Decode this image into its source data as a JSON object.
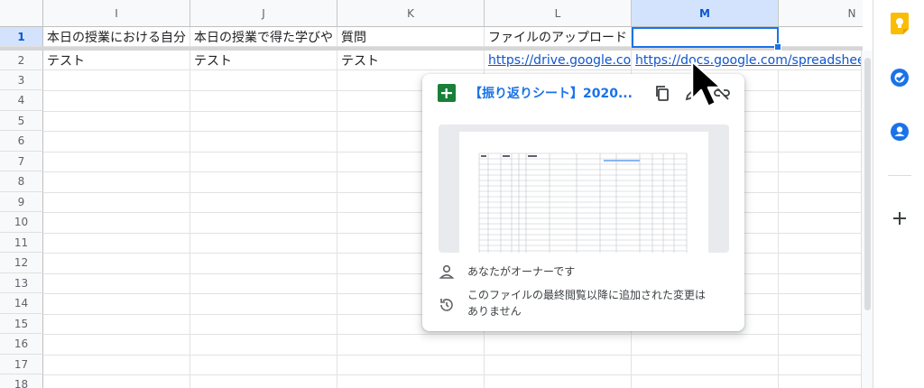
{
  "columns": [
    "I",
    "J",
    "K",
    "L",
    "M",
    "N"
  ],
  "rows": [
    "1",
    "2",
    "3",
    "4",
    "5",
    "6",
    "7",
    "8",
    "9",
    "10",
    "11",
    "12",
    "13",
    "14",
    "15",
    "16",
    "17",
    "18"
  ],
  "cells": {
    "r1": [
      "本日の授業における自分",
      "本日の授業で得た学びや",
      "質問",
      "ファイルのアップロード",
      "",
      ""
    ],
    "r2": [
      "テスト",
      "テスト",
      "テスト",
      "https://drive.google.com/",
      "https://docs.google.com/spreadsheets/d",
      ""
    ]
  },
  "link_card": {
    "title": "【振り返りシート】2020...",
    "owner_text": "あなたがオーナーです",
    "changes_line1": "このファイルの最終閲覧以降に追加された変更は",
    "changes_line2": "ありません",
    "icons": [
      "sheets-icon",
      "copy-link-icon",
      "edit-link-icon",
      "unlink-icon",
      "person-icon",
      "history-icon"
    ]
  },
  "side_panel": {
    "icons": [
      "keep-icon",
      "tasks-icon",
      "contacts-icon",
      "add-icon"
    ]
  },
  "colors": {
    "accent": "#1a73e8",
    "link": "#1155cc",
    "header_bg": "#f8f9fa",
    "sheets_green": "#188038"
  }
}
